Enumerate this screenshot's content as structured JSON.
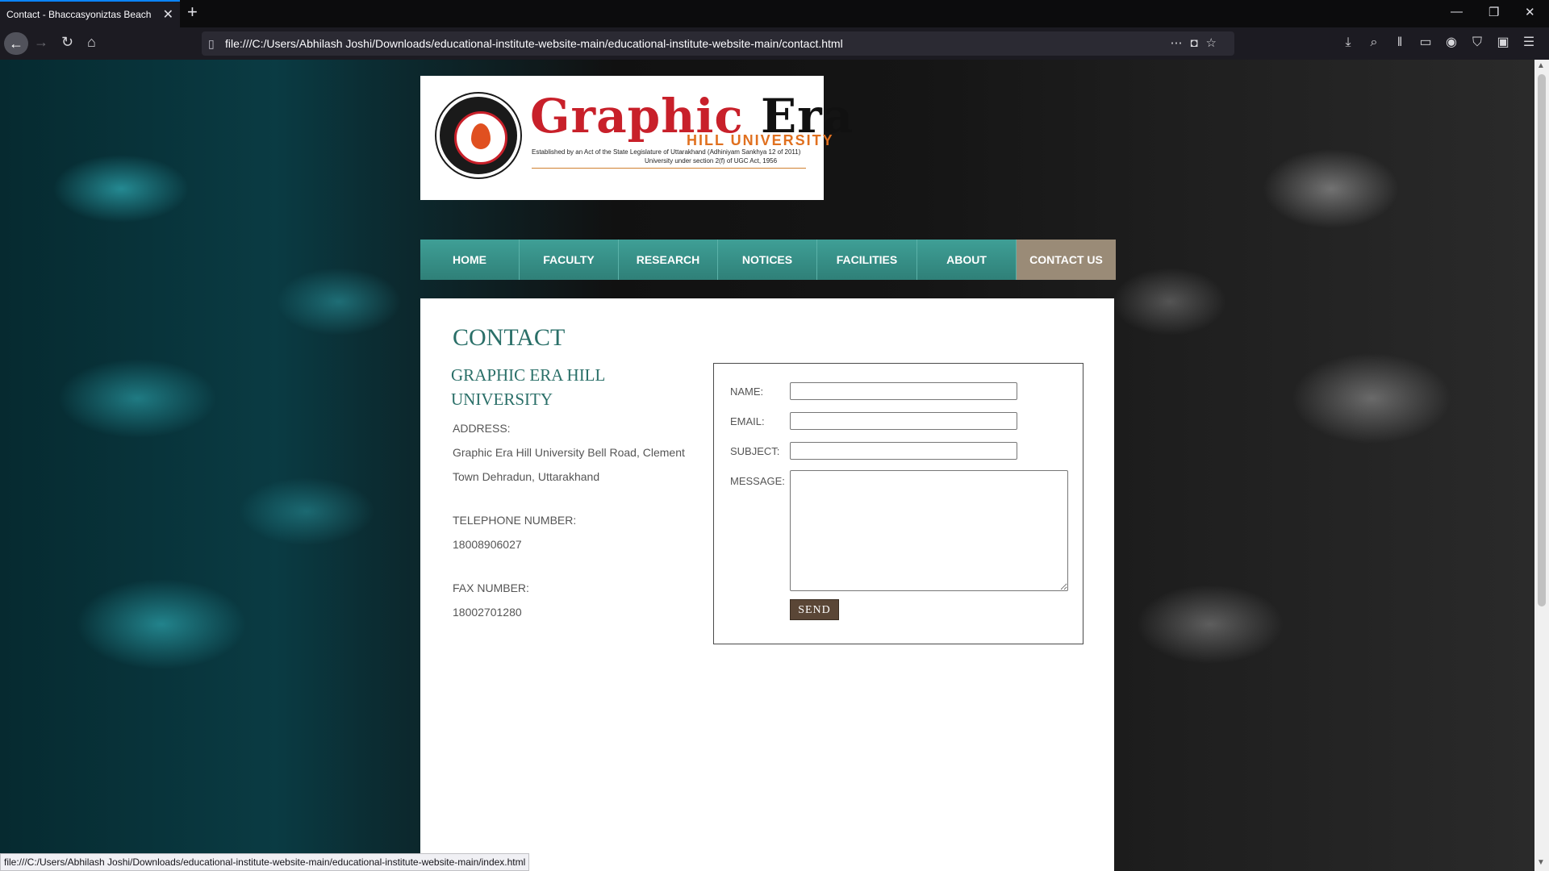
{
  "browser": {
    "tab_title": "Contact - Bhaccasyoniztas Beach R",
    "tab_close": "✕",
    "new_tab": "+",
    "url": "file:///C:/Users/Abhilash Joshi/Downloads/educational-institute-website-main/educational-institute-website-main/contact.html",
    "status_url": "file:///C:/Users/Abhilash Joshi/Downloads/educational-institute-website-main/educational-institute-website-main/index.html"
  },
  "logo": {
    "title_1": "Graphic",
    "title_2": "Era",
    "subtitle": "HILL UNIVERSITY",
    "line1": "Established by an Act of the State Legislature of Uttarakhand (Adhiniyam Sankhya 12 of 2011)",
    "line2": "University under section 2(f) of UGC Act, 1956"
  },
  "menu": {
    "items": [
      "HOME",
      "FACULTY",
      "RESEARCH",
      "NOTICES",
      "FACILITIES",
      "ABOUT",
      "CONTACT US"
    ],
    "active": "CONTACT US"
  },
  "content": {
    "title": "CONTACT",
    "org_name": "GRAPHIC ERA HILL UNIVERSITY",
    "address_label": "ADDRESS:",
    "address": "Graphic Era Hill University Bell Road, Clement Town Dehradun, Uttarakhand",
    "phone_label": "TELEPHONE NUMBER:",
    "phone": "18008906027",
    "fax_label": "FAX NUMBER:",
    "fax": "18002701280"
  },
  "form": {
    "name_label": "NAME:",
    "email_label": "EMAIL:",
    "subject_label": "SUBJECT:",
    "message_label": "MESSAGE:",
    "name_value": "",
    "email_value": "",
    "subject_value": "",
    "message_value": "",
    "send_label": "SEND"
  },
  "colors": {
    "menu_teal": "#3a9389",
    "menu_active": "#9a8b77",
    "heading_teal": "#2a6f68",
    "send_brown": "#5a4636",
    "logo_red": "#c8202a",
    "logo_orange": "#e0701f"
  }
}
